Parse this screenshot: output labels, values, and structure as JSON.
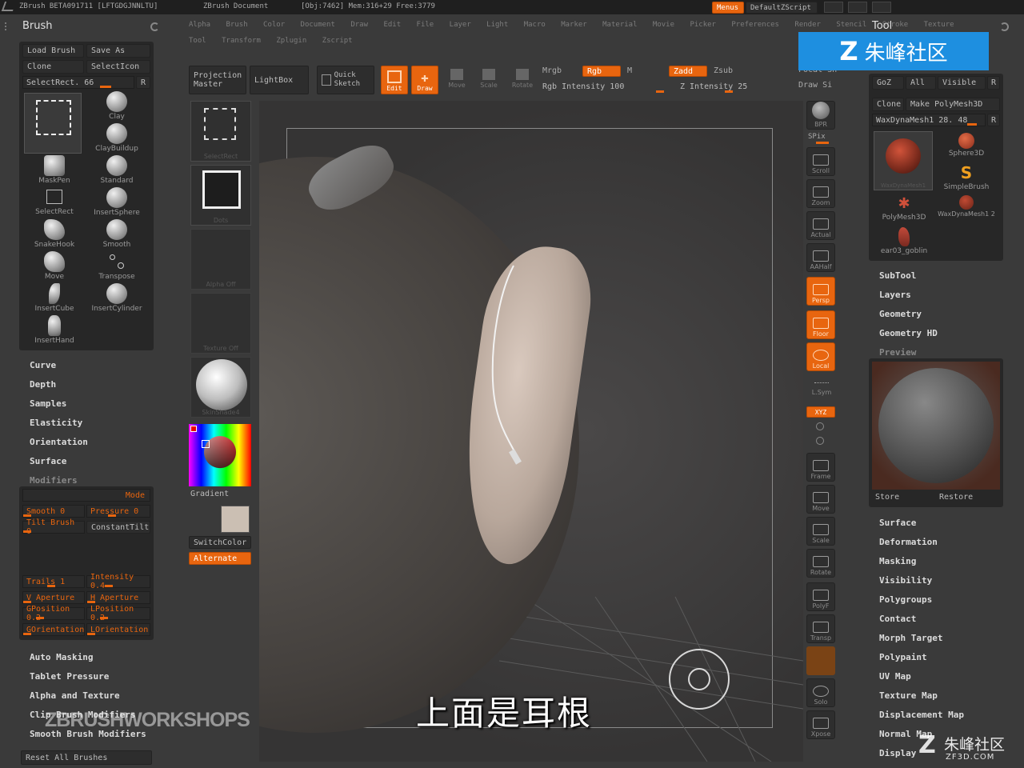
{
  "titlebar": {
    "app": "ZBrush BETA091711 [LFTGDGJNNLTU]",
    "doc": "ZBrush Document",
    "obj": "[Obj:7462] Mem:316+29 Free:3779",
    "menus_btn": "Menus",
    "script": "DefaultZScript"
  },
  "menus_row1": [
    "Alpha",
    "Brush",
    "Color",
    "Document",
    "Draw",
    "Edit",
    "File",
    "Layer",
    "Light",
    "Macro",
    "Marker",
    "Material",
    "Movie",
    "Picker",
    "Preferences",
    "Render",
    "Stencil",
    "Stroke",
    "Texture"
  ],
  "menus_row2": [
    "Tool",
    "Transform",
    "Zplugin",
    "Zscript"
  ],
  "brush_panel": {
    "title": "Brush",
    "load": "Load Brush",
    "save": "Save As",
    "clone": "Clone",
    "selecticon": "SelectIcon",
    "selectrect_label": "SelectRect. 66",
    "r": "R",
    "brushes": [
      {
        "name": "SelectRect"
      },
      {
        "name": "Clay"
      },
      {
        "name": "ClayBuildup"
      },
      {
        "name": "MaskPen"
      },
      {
        "name": "Standard"
      },
      {
        "name": "SelectRect"
      },
      {
        "name": "InsertSphere"
      },
      {
        "name": "SnakeHook"
      },
      {
        "name": "Smooth"
      },
      {
        "name": "Move"
      },
      {
        "name": "Transpose"
      },
      {
        "name": "InsertCube"
      },
      {
        "name": "InsertCylinder"
      },
      {
        "name": "InsertHand"
      }
    ]
  },
  "left_menu": [
    "Curve",
    "Depth",
    "Samples",
    "Elasticity",
    "Orientation",
    "Surface",
    "Modifiers"
  ],
  "modifiers": {
    "mode": "Mode",
    "smooth": "Smooth 0",
    "pressure": "Pressure 0",
    "tilt": "Tilt Brush 0",
    "constanttilt": "ConstantTilt",
    "trails": "Trails 1",
    "intensity": "Intensity 0.4",
    "vaperture": "V Aperture",
    "haperture": "H Aperture",
    "gposition": "GPosition 0.2",
    "lposition": "LPosition 0.2",
    "gorientation": "GOrientation",
    "lorientation": "LOrientation"
  },
  "left_menu2": [
    "Auto Masking",
    "Tablet Pressure",
    "Alpha and Texture",
    "Clip Brush Modifiers",
    "Smooth Brush Modifiers"
  ],
  "reset_all": "Reset All Brushes",
  "watermark_left": "ZBRUSHWORKSHOPS",
  "toolbar": {
    "projection_master": "Projection Master",
    "lightbox": "LightBox",
    "quick_sketch": "Quick Sketch",
    "edit": "Edit",
    "draw": "Draw",
    "move": "Move",
    "scale": "Scale",
    "rotate": "Rotate",
    "mrgb": "Mrgb",
    "rgb": "Rgb",
    "m": "M",
    "rgb_intensity": "Rgb Intensity 100",
    "zadd": "Zadd",
    "zsub": "Zsub",
    "z_intensity": "Z Intensity 25",
    "focal": "Focal Sh",
    "draw_size": "Draw Si"
  },
  "palette": {
    "slot1": "SelectRect",
    "slot2": "Dots",
    "slot3": "Alpha Off",
    "slot4": "Texture Off",
    "slot5": "SkinShade4",
    "gradient": "Gradient",
    "switchcolor": "SwitchColor",
    "alternate": "Alternate"
  },
  "right_tools": [
    {
      "label": "BPR",
      "on": false
    },
    {
      "label": "SPix",
      "on": false
    },
    {
      "label": "Scroll",
      "on": false
    },
    {
      "label": "Zoom",
      "on": false
    },
    {
      "label": "Actual",
      "on": false
    },
    {
      "label": "AAHalf",
      "on": false
    },
    {
      "label": "Persp",
      "on": true
    },
    {
      "label": "Floor",
      "on": true
    },
    {
      "label": "Local",
      "on": true
    },
    {
      "label": "L.Sym",
      "on": false
    },
    {
      "label": "XYZ",
      "on": true
    },
    {
      "label": "Frame",
      "on": false
    },
    {
      "label": "Move",
      "on": false
    },
    {
      "label": "Scale",
      "on": false
    },
    {
      "label": "Rotate",
      "on": false
    },
    {
      "label": "PolyF",
      "on": false
    },
    {
      "label": "Transp",
      "on": false
    },
    {
      "label": "Solo",
      "on": false
    },
    {
      "label": "Xpose",
      "on": false
    }
  ],
  "tool_panel": {
    "title": "Tool",
    "goz": "GoZ",
    "all": "All",
    "visible": "Visible",
    "r": "R",
    "clone": "Clone",
    "make_polymesh": "Make PolyMesh3D",
    "current": "WaxDynaMesh1 28. 48",
    "tools": [
      "WaxDynaMesh1",
      "Sphere3D",
      "SimpleBrush",
      "PolyMesh3D",
      "WaxDynaMesh1 2",
      "ear03_goblin"
    ],
    "menu": [
      "SubTool",
      "Layers",
      "Geometry",
      "Geometry HD",
      "Preview"
    ],
    "store": "Store",
    "restore": "Restore",
    "menu2": [
      "Surface",
      "Deformation",
      "Masking",
      "Visibility",
      "Polygroups",
      "Contact",
      "Morph Target",
      "Polypaint",
      "UV Map",
      "Texture Map",
      "Displacement Map",
      "Normal Map",
      "Display"
    ]
  },
  "subtitle": "上面是耳根",
  "watermark_brand": "朱峰社区",
  "watermark_url": "ZF3D.COM"
}
